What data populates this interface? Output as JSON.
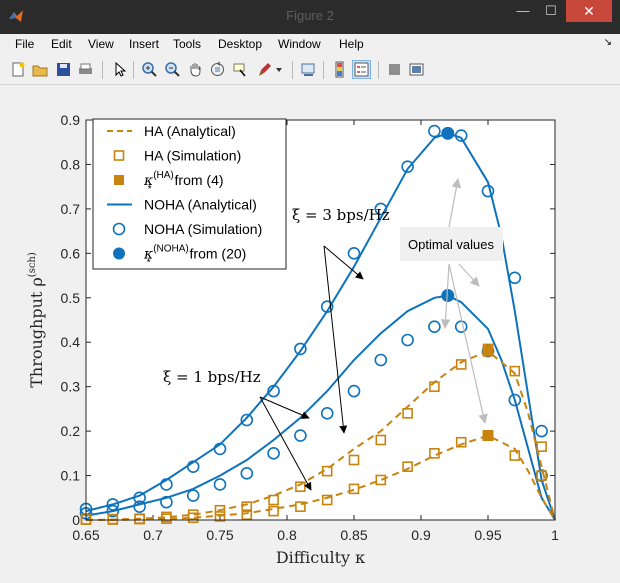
{
  "window": {
    "title": "Figure 2",
    "minimize_symbol": "—",
    "maximize_symbol": "☐",
    "close_symbol": "✕"
  },
  "menu": [
    "File",
    "Edit",
    "View",
    "Insert",
    "Tools",
    "Desktop",
    "Window",
    "Help"
  ],
  "menu_overflow_symbol": "↘",
  "toolbar_icons": [
    "new-figure-icon",
    "open-file-icon",
    "save-icon",
    "print-icon",
    "pointer-icon",
    "zoom-in-icon",
    "zoom-out-icon",
    "pan-hand-icon",
    "rotate-3d-icon",
    "data-cursor-icon",
    "brush-icon",
    "brush-dropdown-icon",
    "link-plot-icon",
    "colorbar-icon",
    "legend-icon",
    "hide-plot-tools-icon",
    "show-plot-tools-icon"
  ],
  "colors": {
    "ha": "#c8830f",
    "noha": "#0e72bd",
    "close": "#c7473a"
  },
  "chart_data": {
    "type": "line",
    "xlabel": "Difficulty κ",
    "ylabel": "Throughput ρ",
    "ylabel_superscript": "(sch)",
    "xlim": [
      0.65,
      1.0
    ],
    "ylim": [
      0,
      0.9
    ],
    "xticks": [
      "0.65",
      "0.7",
      "0.75",
      "0.8",
      "0.85",
      "0.9",
      "0.95",
      "1"
    ],
    "yticks": [
      "0",
      "0.1",
      "0.2",
      "0.3",
      "0.4",
      "0.5",
      "0.6",
      "0.7",
      "0.8",
      "0.9"
    ],
    "legend_position": "top-left",
    "legend": [
      {
        "label": "HA (Analytical)",
        "style": "dashed-line",
        "color": "#c8830f"
      },
      {
        "label": "HA (Simulation)",
        "style": "square-marker",
        "color": "#c8830f"
      },
      {
        "label": "κ",
        "sub": "*",
        "sup": "(HA)",
        "suffix": " from (4)",
        "style": "filled-square",
        "color": "#c8830f"
      },
      {
        "label": "NOHA (Analytical)",
        "style": "solid-line",
        "color": "#0e72bd"
      },
      {
        "label": "NOHA (Simulation)",
        "style": "circle-marker",
        "color": "#0e72bd"
      },
      {
        "label": "κ",
        "sub": "*",
        "sup": "(NOHA)",
        "suffix": " from (20)",
        "style": "filled-circle",
        "color": "#0e72bd"
      }
    ],
    "annotations": {
      "xi3": "ξ = 3 bps/Hz",
      "xi1": "ξ = 1 bps/Hz",
      "optimal": "Optimal values"
    },
    "series": [
      {
        "name": "NOHA (Analytical)",
        "group": "xi3",
        "x": [
          0.65,
          0.67,
          0.69,
          0.71,
          0.73,
          0.75,
          0.77,
          0.79,
          0.81,
          0.83,
          0.85,
          0.87,
          0.89,
          0.91,
          0.92,
          0.93,
          0.95,
          0.96,
          0.97,
          0.98,
          0.99,
          1.0
        ],
        "y": [
          0.02,
          0.035,
          0.055,
          0.09,
          0.13,
          0.17,
          0.23,
          0.3,
          0.38,
          0.47,
          0.57,
          0.68,
          0.79,
          0.86,
          0.87,
          0.86,
          0.76,
          0.64,
          0.47,
          0.28,
          0.09,
          0.0
        ]
      },
      {
        "name": "NOHA (Simulation)",
        "group": "xi3",
        "x": [
          0.65,
          0.67,
          0.69,
          0.71,
          0.73,
          0.75,
          0.77,
          0.79,
          0.81,
          0.83,
          0.85,
          0.87,
          0.89,
          0.91,
          0.93,
          0.95,
          0.97,
          0.99
        ],
        "y": [
          0.025,
          0.035,
          0.05,
          0.08,
          0.12,
          0.16,
          0.225,
          0.29,
          0.385,
          0.48,
          0.6,
          0.7,
          0.795,
          0.875,
          0.865,
          0.74,
          0.545,
          0.2
        ]
      },
      {
        "name": "κ* (NOHA) from (20)",
        "group": "xi3",
        "x": [
          0.92
        ],
        "y": [
          0.87
        ]
      },
      {
        "name": "NOHA (Analytical)",
        "group": "xi1",
        "x": [
          0.65,
          0.67,
          0.69,
          0.71,
          0.73,
          0.75,
          0.77,
          0.79,
          0.81,
          0.83,
          0.85,
          0.87,
          0.89,
          0.91,
          0.92,
          0.93,
          0.95,
          0.96,
          0.97,
          0.98,
          0.99,
          1.0
        ],
        "y": [
          0.01,
          0.02,
          0.035,
          0.05,
          0.07,
          0.1,
          0.135,
          0.18,
          0.23,
          0.29,
          0.36,
          0.42,
          0.47,
          0.5,
          0.505,
          0.49,
          0.43,
          0.36,
          0.27,
          0.16,
          0.05,
          0.0
        ]
      },
      {
        "name": "NOHA (Simulation)",
        "group": "xi1",
        "x": [
          0.65,
          0.67,
          0.69,
          0.71,
          0.73,
          0.75,
          0.77,
          0.79,
          0.81,
          0.83,
          0.85,
          0.87,
          0.89,
          0.91,
          0.93,
          0.95,
          0.97,
          0.99
        ],
        "y": [
          0.015,
          0.02,
          0.03,
          0.04,
          0.055,
          0.08,
          0.105,
          0.15,
          0.19,
          0.24,
          0.29,
          0.36,
          0.405,
          0.435,
          0.435,
          0.38,
          0.27,
          0.1
        ]
      },
      {
        "name": "κ* (NOHA) from (20)",
        "group": "xi1",
        "x": [
          0.92
        ],
        "y": [
          0.505
        ]
      },
      {
        "name": "HA (Analytical)",
        "group": "xi3",
        "x": [
          0.65,
          0.67,
          0.69,
          0.71,
          0.73,
          0.75,
          0.77,
          0.79,
          0.81,
          0.83,
          0.85,
          0.87,
          0.89,
          0.91,
          0.93,
          0.95,
          0.97,
          0.98,
          0.99,
          1.0
        ],
        "y": [
          0.0,
          0.001,
          0.003,
          0.006,
          0.012,
          0.022,
          0.035,
          0.055,
          0.08,
          0.115,
          0.16,
          0.2,
          0.255,
          0.31,
          0.355,
          0.38,
          0.33,
          0.24,
          0.12,
          0.0
        ]
      },
      {
        "name": "HA (Simulation)",
        "group": "xi3",
        "x": [
          0.65,
          0.67,
          0.69,
          0.71,
          0.73,
          0.75,
          0.77,
          0.79,
          0.81,
          0.83,
          0.85,
          0.87,
          0.89,
          0.91,
          0.93,
          0.95,
          0.97,
          0.99
        ],
        "y": [
          0.001,
          0.002,
          0.003,
          0.007,
          0.012,
          0.022,
          0.03,
          0.045,
          0.075,
          0.11,
          0.135,
          0.18,
          0.24,
          0.3,
          0.35,
          0.385,
          0.335,
          0.165
        ]
      },
      {
        "name": "κ* (HA) from (4)",
        "group": "xi3",
        "x": [
          0.95
        ],
        "y": [
          0.38
        ]
      },
      {
        "name": "HA (Analytical)",
        "group": "xi1",
        "x": [
          0.65,
          0.67,
          0.69,
          0.71,
          0.73,
          0.75,
          0.77,
          0.79,
          0.81,
          0.83,
          0.85,
          0.87,
          0.89,
          0.91,
          0.93,
          0.95,
          0.97,
          0.98,
          0.99,
          1.0
        ],
        "y": [
          0.0,
          0.0,
          0.001,
          0.002,
          0.005,
          0.01,
          0.015,
          0.025,
          0.035,
          0.05,
          0.068,
          0.09,
          0.115,
          0.145,
          0.17,
          0.19,
          0.16,
          0.11,
          0.05,
          0.0
        ]
      },
      {
        "name": "HA (Simulation)",
        "group": "xi1",
        "x": [
          0.65,
          0.67,
          0.69,
          0.71,
          0.73,
          0.75,
          0.77,
          0.79,
          0.81,
          0.83,
          0.85,
          0.87,
          0.89,
          0.91,
          0.93,
          0.95,
          0.97,
          0.99
        ],
        "y": [
          0.001,
          0.001,
          0.002,
          0.003,
          0.005,
          0.008,
          0.012,
          0.02,
          0.03,
          0.045,
          0.07,
          0.09,
          0.12,
          0.15,
          0.175,
          0.19,
          0.145,
          0.1
        ]
      },
      {
        "name": "κ* (HA) from (4)",
        "group": "xi1",
        "x": [
          0.95
        ],
        "y": [
          0.19
        ]
      }
    ]
  }
}
